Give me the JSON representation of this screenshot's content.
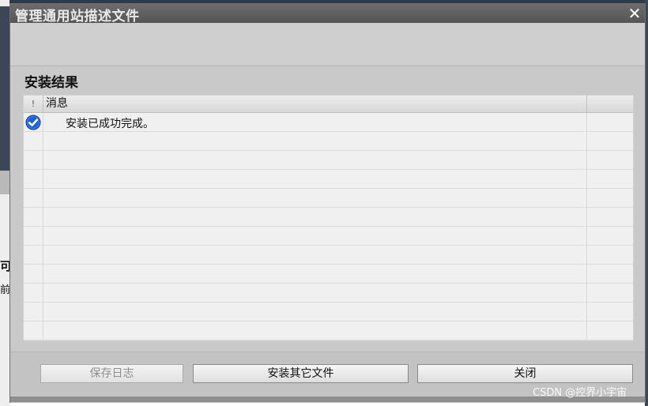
{
  "dialog": {
    "title": "管理通用站描述文件",
    "close_glyph": "✕"
  },
  "section": {
    "title": "安装结果"
  },
  "table": {
    "columns": [
      "!",
      "消息"
    ],
    "rows": [
      {
        "status_icon": "check-circle-icon",
        "message": "安装已成功完成。"
      }
    ]
  },
  "buttons": {
    "save_log": "保存日志",
    "install_other": "安装其它文件",
    "close": "关闭"
  },
  "background": {
    "fragment1": "可",
    "fragment2": "前"
  },
  "watermark": "CSDN @控界小宇宙",
  "colors": {
    "titlebar": "#5f5f5f",
    "dialog_bg": "#c9c9c9",
    "check_blue": "#1f5fd6"
  }
}
